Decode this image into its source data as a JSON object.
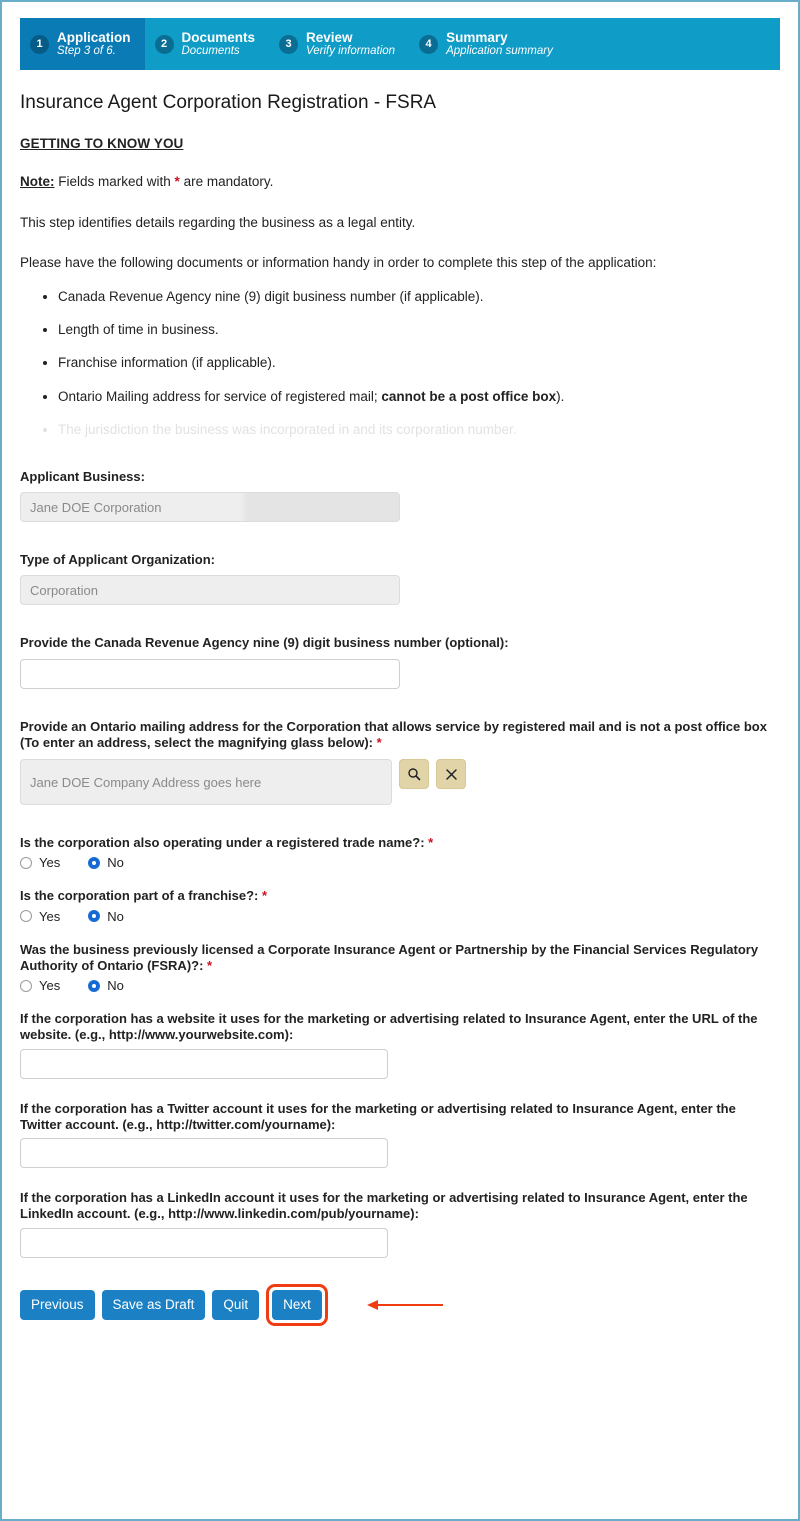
{
  "wizard": {
    "steps": [
      {
        "num": "1",
        "title": "Application",
        "sub": "Step 3 of 6.",
        "active": true
      },
      {
        "num": "2",
        "title": "Documents",
        "sub": "Documents",
        "active": false
      },
      {
        "num": "3",
        "title": "Review",
        "sub": "Verify information",
        "active": false
      },
      {
        "num": "4",
        "title": "Summary",
        "sub": "Application summary",
        "active": false
      }
    ]
  },
  "page_title": "Insurance Agent Corporation Registration - FSRA",
  "section_title": "GETTING TO KNOW YOU",
  "note": {
    "label": "Note:",
    "text_before": " Fields marked with ",
    "asterisk": "*",
    "text_after": " are mandatory."
  },
  "intro_paragraph": "This step identifies details regarding the business as a legal entity.",
  "handy_paragraph": "Please have the following documents or information handy in order to complete this step of the application:",
  "bullets": [
    {
      "text": "Canada Revenue Agency nine (9) digit business number (if applicable).",
      "faded": false
    },
    {
      "text": "Length of time in business.",
      "faded": false
    },
    {
      "text": "Franchise information (if applicable).",
      "faded": false
    },
    {
      "prefix": "Ontario Mailing address for service of registered mail; ",
      "bold": "cannot be a post office box",
      "suffix": ").",
      "faded": false
    },
    {
      "text": "The jurisdiction the business was incorporated in and its corporation number.",
      "faded": true
    }
  ],
  "fields": {
    "applicant_business": {
      "label": "Applicant Business:",
      "value": "Jane DOE Corporation"
    },
    "org_type": {
      "label": "Type of Applicant Organization:",
      "value": "Corporation"
    },
    "cra_number": {
      "label": "Provide the Canada Revenue Agency nine (9) digit business number (optional):",
      "value": ""
    },
    "mailing_address": {
      "label": "Provide an Ontario mailing address for the Corporation that allows service by registered mail and is not a post office box (To enter an address, select the magnifying glass below): ",
      "required": "*",
      "value": "Jane DOE Company Address goes here",
      "search_icon": "magnifying-glass-icon",
      "clear_icon": "close-x-icon"
    },
    "website": {
      "label": "If the corporation has a website it uses for the marketing or advertising related to Insurance Agent, enter the URL of the website. (e.g., http://www.yourwebsite.com):",
      "value": ""
    },
    "twitter": {
      "label": "If the corporation has a Twitter account it uses for the marketing or advertising related to Insurance Agent, enter the Twitter account. (e.g., http://twitter.com/yourname):",
      "value": ""
    },
    "linkedin": {
      "label": "If the corporation has a LinkedIn account it uses for the marketing or advertising related to Insurance Agent, enter the LinkedIn account. (e.g., http://www.linkedin.com/pub/yourname):",
      "value": ""
    }
  },
  "radio_questions": [
    {
      "label": "Is the corporation also operating under a registered trade name?: ",
      "required": "*",
      "yes": "Yes",
      "no": "No",
      "selected": "No"
    },
    {
      "label": "Is the corporation part of a franchise?: ",
      "required": "*",
      "yes": "Yes",
      "no": "No",
      "selected": "No"
    },
    {
      "label": "Was the business previously licensed a Corporate Insurance Agent or Partnership by the Financial Services Regulatory Authority of Ontario (FSRA)?: ",
      "required": "*",
      "yes": "Yes",
      "no": "No",
      "selected": "No"
    }
  ],
  "buttons": {
    "previous": "Previous",
    "save_draft": "Save as Draft",
    "quit": "Quit",
    "next": "Next"
  },
  "colors": {
    "accent_blue": "#1b81c4",
    "header_active": "#0b7bb5",
    "header_inactive": "#0f9cc6",
    "required_red": "#cc1122",
    "annotation_red": "#f03c12",
    "icon_button_tan": "#e2d4a9",
    "page_border": "#69aec9"
  }
}
